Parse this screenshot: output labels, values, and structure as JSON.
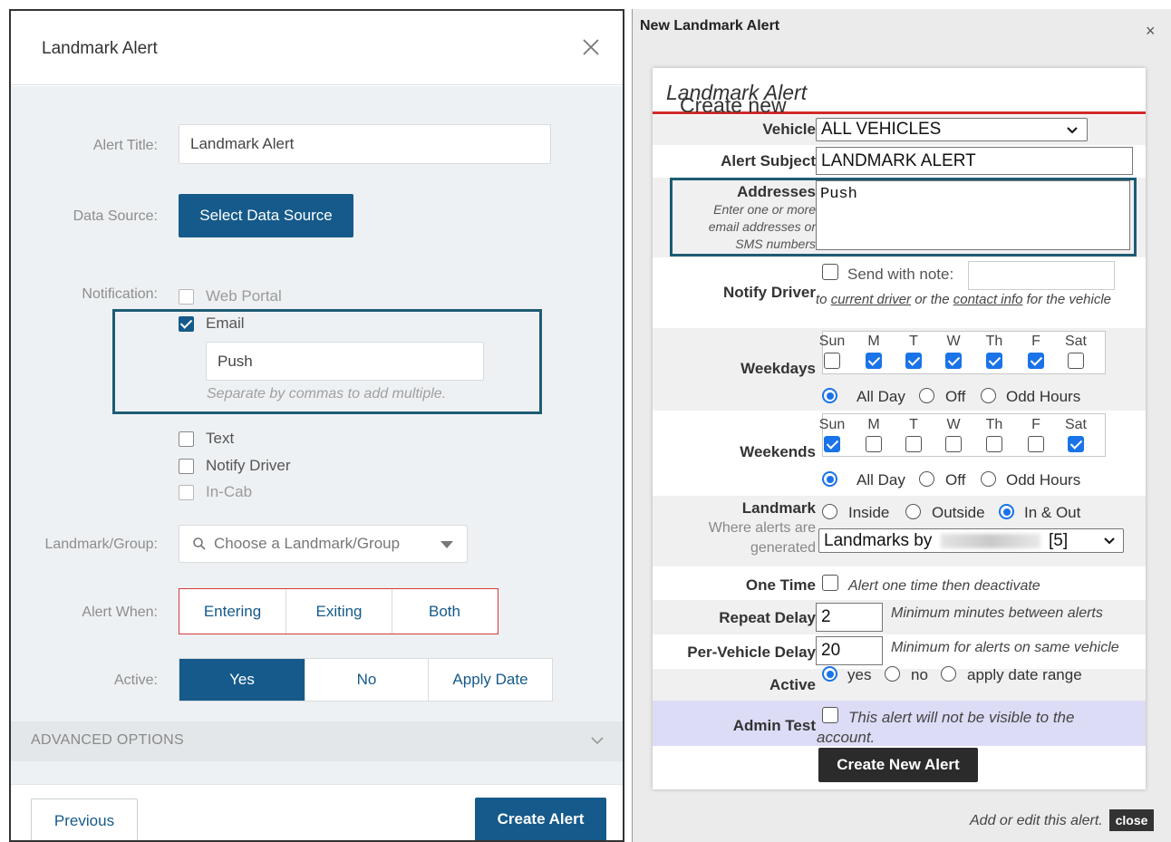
{
  "left": {
    "title": "Landmark Alert",
    "alert_title_label": "Alert Title:",
    "alert_title_value": "Landmark Alert",
    "data_source_label": "Data Source:",
    "data_source_button": "Select Data Source",
    "notification_label": "Notification:",
    "notifications": {
      "web_portal": "Web Portal",
      "email": "Email",
      "email_value": "Push",
      "email_hint": "Separate by commas to add multiple.",
      "text": "Text",
      "notify_driver": "Notify Driver",
      "in_cab": "In-Cab"
    },
    "landmark_label": "Landmark/Group:",
    "landmark_placeholder": "Choose a Landmark/Group",
    "alert_when_label": "Alert When:",
    "alert_when": [
      "Entering",
      "Exiting",
      "Both"
    ],
    "active_label": "Active:",
    "active": [
      "Yes",
      "No",
      "Apply Date"
    ],
    "advanced": "ADVANCED OPTIONS",
    "previous": "Previous",
    "create": "Create Alert",
    "colors": {
      "primary": "#155a8a",
      "highlight": "#1d5c73",
      "alert_when_border": "#d93a3a"
    }
  },
  "right": {
    "title": "New Landmark Alert",
    "close_x": "×",
    "heading_prefix": "Create new ",
    "heading_italic": "Landmark Alert",
    "vehicle_label": "Vehicle",
    "vehicle_value": "ALL VEHICLES",
    "subject_label": "Alert Subject",
    "subject_value": "LANDMARK ALERT",
    "addresses_label": "Addresses",
    "addresses_hint": "Enter one or more email addresses or SMS numbers",
    "addresses_value": "Push",
    "notify_label": "Notify Driver",
    "notify_send": "Send with note:",
    "notify_to": "to ",
    "notify_current": "current driver",
    "notify_or": " or the ",
    "notify_contact": "contact info",
    "notify_for": " for the vehicle",
    "days": [
      "Sun",
      "M",
      "T",
      "W",
      "Th",
      "F",
      "Sat"
    ],
    "weekdays_label": "Weekdays",
    "weekdays_checked": [
      false,
      true,
      true,
      true,
      true,
      true,
      false
    ],
    "weekends_label": "Weekends",
    "weekends_checked": [
      true,
      false,
      false,
      false,
      false,
      false,
      true
    ],
    "time_options": [
      "All Day",
      "Off",
      "Odd Hours"
    ],
    "landmark_label": "Landmark",
    "landmark_sub": "Where alerts are generated",
    "landmark_options": [
      "Inside",
      "Outside",
      "In & Out"
    ],
    "landmark_select": "Landmarks by",
    "landmark_count": "[5]",
    "one_time_label": "One Time",
    "one_time_text": "Alert one time then deactivate",
    "repeat_label": "Repeat Delay",
    "repeat_value": "2",
    "repeat_hint": "Minimum minutes between alerts",
    "pervehicle_label": "Per-Vehicle Delay",
    "pervehicle_value": "20",
    "pervehicle_hint": "Minimum for alerts on same vehicle",
    "active_label": "Active",
    "active_options": [
      "yes",
      "no",
      "apply date range"
    ],
    "admin_label": "Admin Test",
    "admin_text": "This alert will not be visible to the account.",
    "create_button": "Create New Alert",
    "footer_text": "Add or edit this alert.",
    "footer_close": "close",
    "colors": {
      "accent_red": "#d12a2a",
      "checkbox_blue": "#1a73e8",
      "admin_bg": "#dcdcf6"
    }
  }
}
